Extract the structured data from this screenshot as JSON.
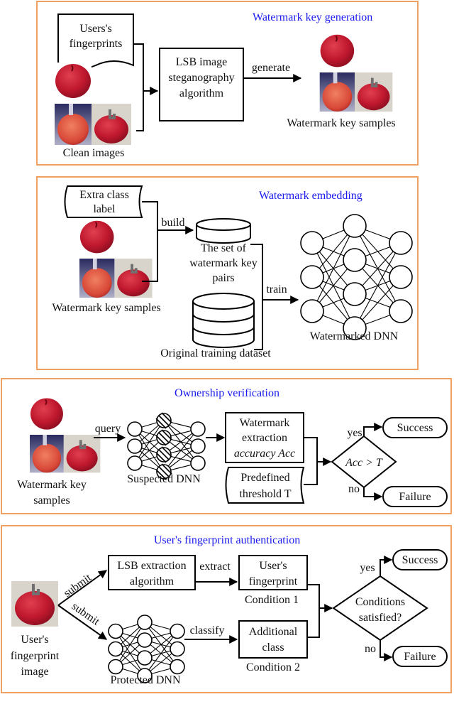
{
  "panels": [
    {
      "title": "Watermark key generation",
      "doc_label_1": "Users's",
      "doc_label_2": "fingerprints",
      "clean_images_label": "Clean images",
      "process_1": "LSB image",
      "process_2": "steganography",
      "process_3": "algorithm",
      "arrow_label": "generate",
      "output_label": "Watermark key samples"
    },
    {
      "title": "Watermark embedding",
      "label_box_1": "Extra class",
      "label_box_2": "label",
      "samples_label": "Watermark key samples",
      "build_label": "build",
      "set_label_1": "The set of",
      "set_label_2": "watermark key",
      "set_label_3": "pairs",
      "train_label": "train",
      "dataset_label": "Original training dataset",
      "dnn_label": "Watermarked DNN"
    },
    {
      "title": "Ownership verification",
      "samples_label_1": "Watermark key",
      "samples_label_2": "samples",
      "query_label": "query",
      "dnn_label": "Suspected DNN",
      "acc_box_1": "Watermark",
      "acc_box_2": "extraction",
      "acc_box_3": "accuracy Acc",
      "threshold_1": "Predefined",
      "threshold_2": "threshold T",
      "decision": "Acc > T",
      "yes": "yes",
      "no": "no",
      "success": "Success",
      "failure": "Failure"
    },
    {
      "title": "User's fingerprint authentication",
      "image_label_1": "User's",
      "image_label_2": "fingerprint",
      "image_label_3": "image",
      "submit_1": "submit",
      "submit_2": "submit",
      "lsb_box_1": "LSB extraction",
      "lsb_box_2": "algorithm",
      "extract_label": "extract",
      "fp_box_1": "User's",
      "fp_box_2": "fingerprint",
      "condition_1": "Condition 1",
      "classify_label": "classify",
      "class_box_1": "Additional",
      "class_box_2": "class",
      "condition_2": "Condition 2",
      "dnn_label": "Protected DNN",
      "decision_1": "Conditions",
      "decision_2": "satisfied?",
      "yes": "yes",
      "no": "no",
      "success": "Success",
      "failure": "Failure"
    }
  ],
  "colors": {
    "panel_border": "#f0a060",
    "title_text": "#1a1aee",
    "apple_red": "#c0182e"
  }
}
